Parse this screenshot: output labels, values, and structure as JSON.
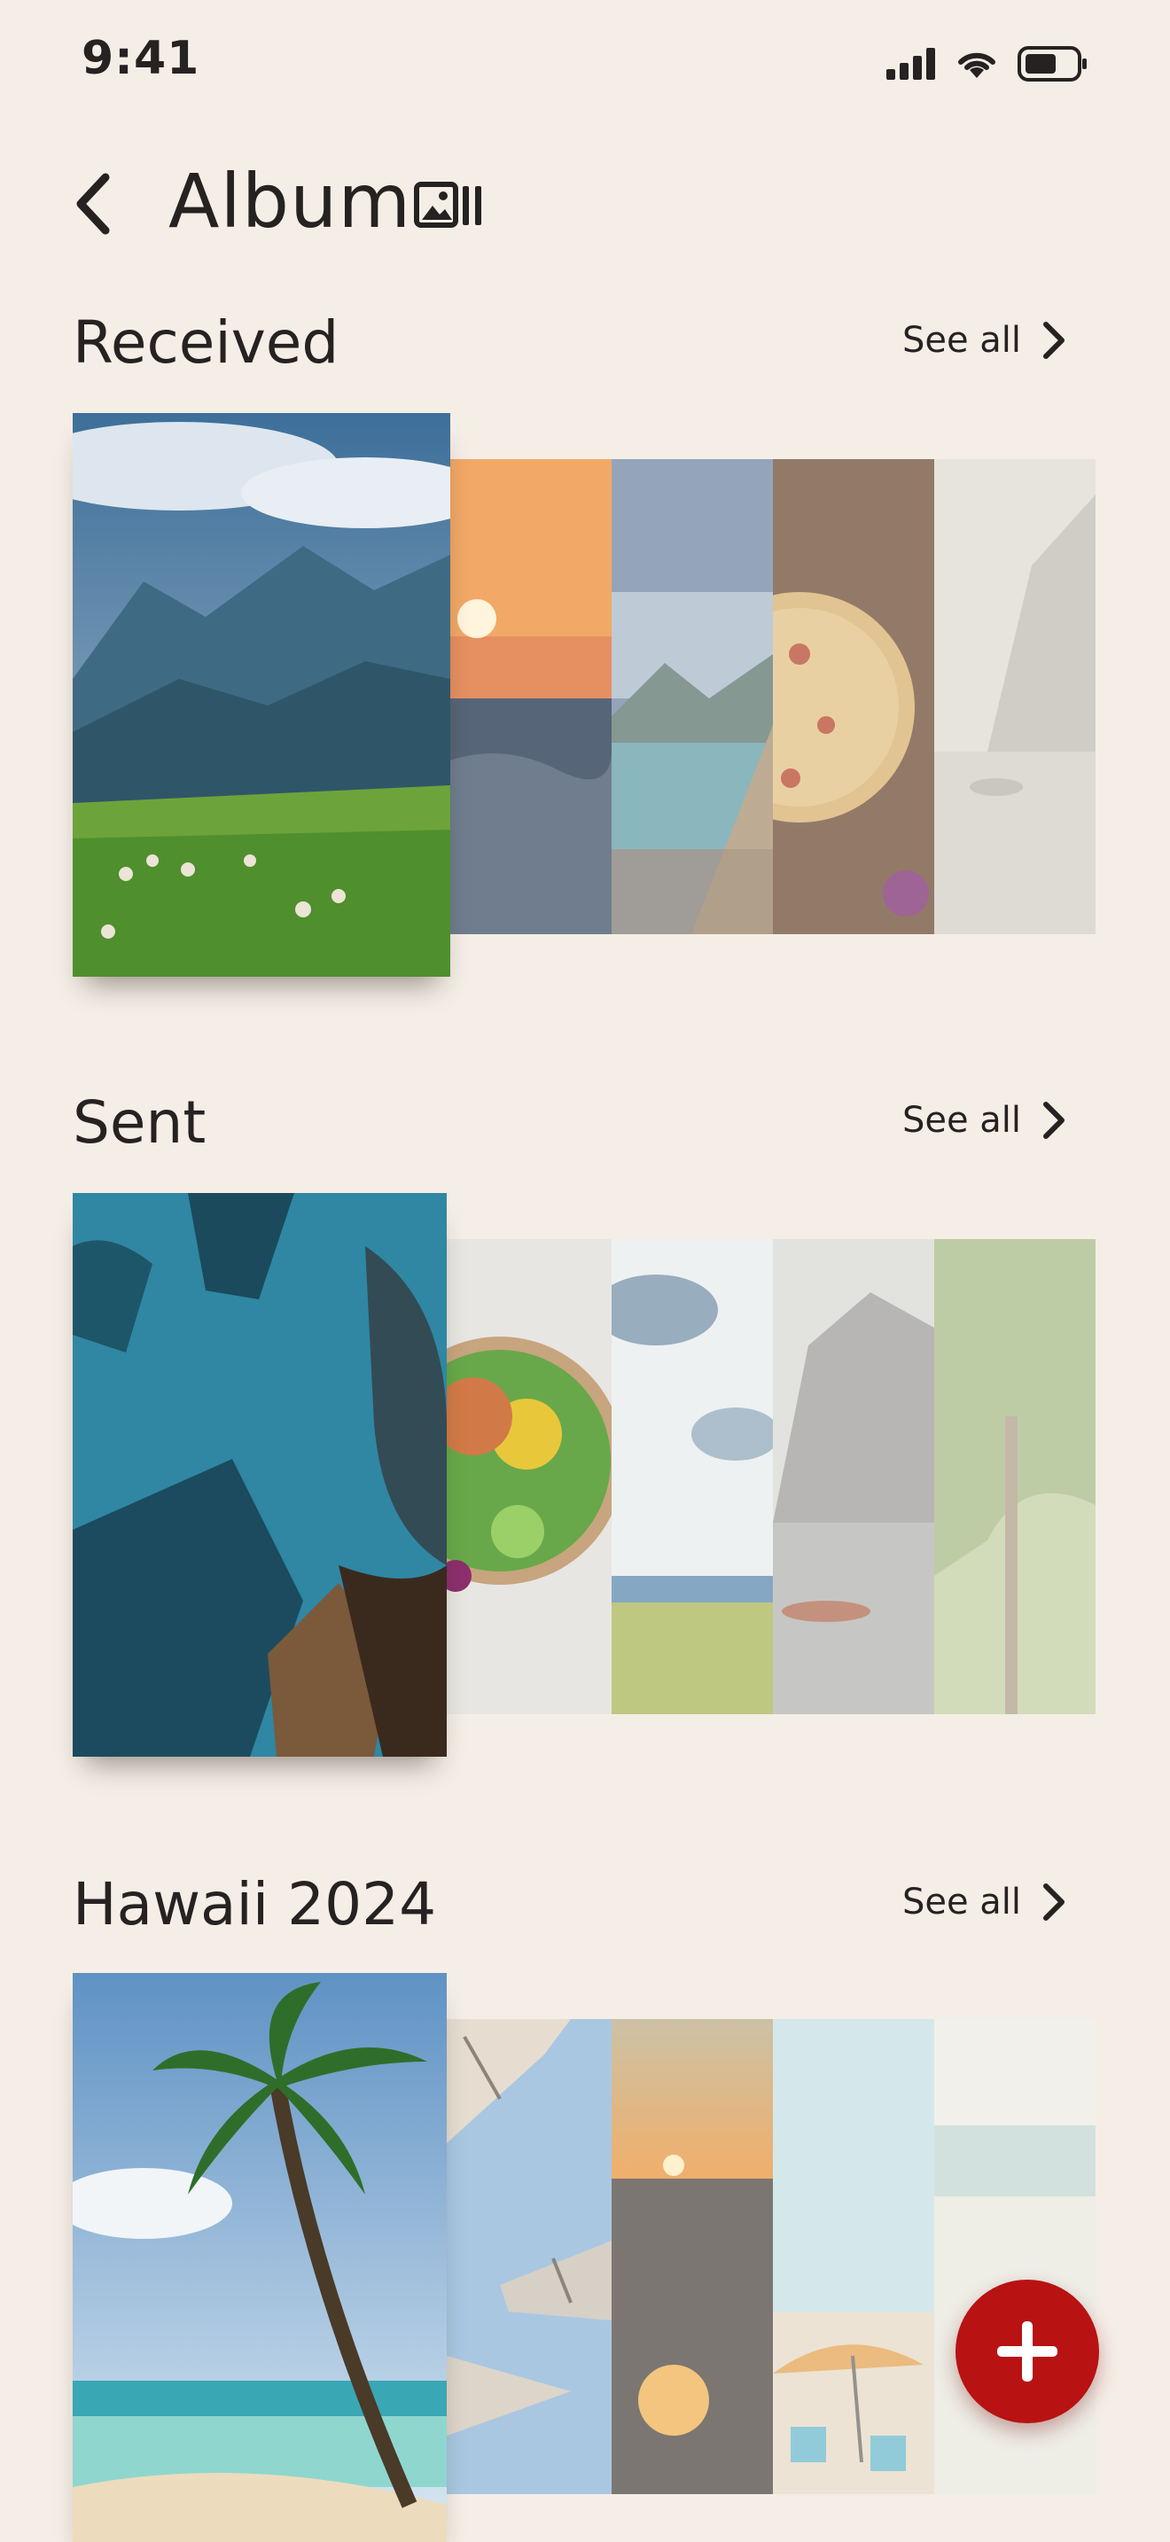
{
  "status_bar": {
    "time": "9:41"
  },
  "header": {
    "title": "Album"
  },
  "sections": [
    {
      "title": "Received",
      "see_all": "See all"
    },
    {
      "title": "Sent",
      "see_all": "See all"
    },
    {
      "title": "Hawaii 2024",
      "see_all": "See all"
    }
  ],
  "colors": {
    "background": "#f5eee6",
    "accent": "#b81212",
    "text": "#262222"
  },
  "icons": [
    "back-icon",
    "album-icon",
    "chevron-right-icon",
    "plus-icon",
    "signal-icon",
    "wifi-icon",
    "battery-icon"
  ]
}
